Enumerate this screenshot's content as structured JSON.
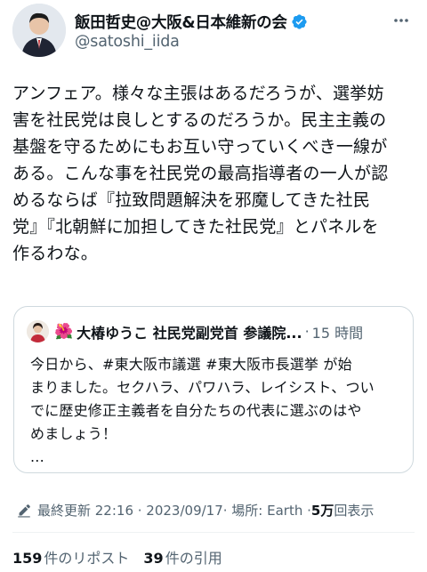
{
  "author": {
    "display_name": "飯田哲史@大阪&日本維新の会",
    "handle": "@satoshi_iida",
    "verified_badge": "verified-badge-icon",
    "accent": "#1d9bf0"
  },
  "tweet": {
    "text": "アンフェア。様々な主張はあるだろうが、選挙妨\n害を社民党は良しとするのだろうか。民主主義の\n基盤を守るためにもお互い守っていくべき一線が\nある。こんな事を社民党の最高指導者の一人が認\nめるならば『拉致問題解決を邪魔してきた社民\n党』『北朝鮮に加担してきた社民党』とパネルを\n作るわな。"
  },
  "quote": {
    "flower": "🌺",
    "name": "大椿ゆうこ 社民党副党首 参議院...",
    "sep": "·",
    "time": "15 時間",
    "text": "今日から、#東大阪市議選 #東大阪市長選挙 が始\nまりました。セクハラ、パワハラ、レイシスト、つい\nでに歴史修正主義者を自分たちの代表に選ぶのはや\nめましょう！\n..."
  },
  "meta": {
    "edited_label": "最終更新 22:16 · 2023/09/17",
    "location": " · 場所: Earth · ",
    "views_count": "5万",
    "views_label": "回表示"
  },
  "stats": {
    "reposts_count": "159",
    "reposts_label": "件のリポスト",
    "quotes_count": "39",
    "quotes_label": "件の引用"
  }
}
